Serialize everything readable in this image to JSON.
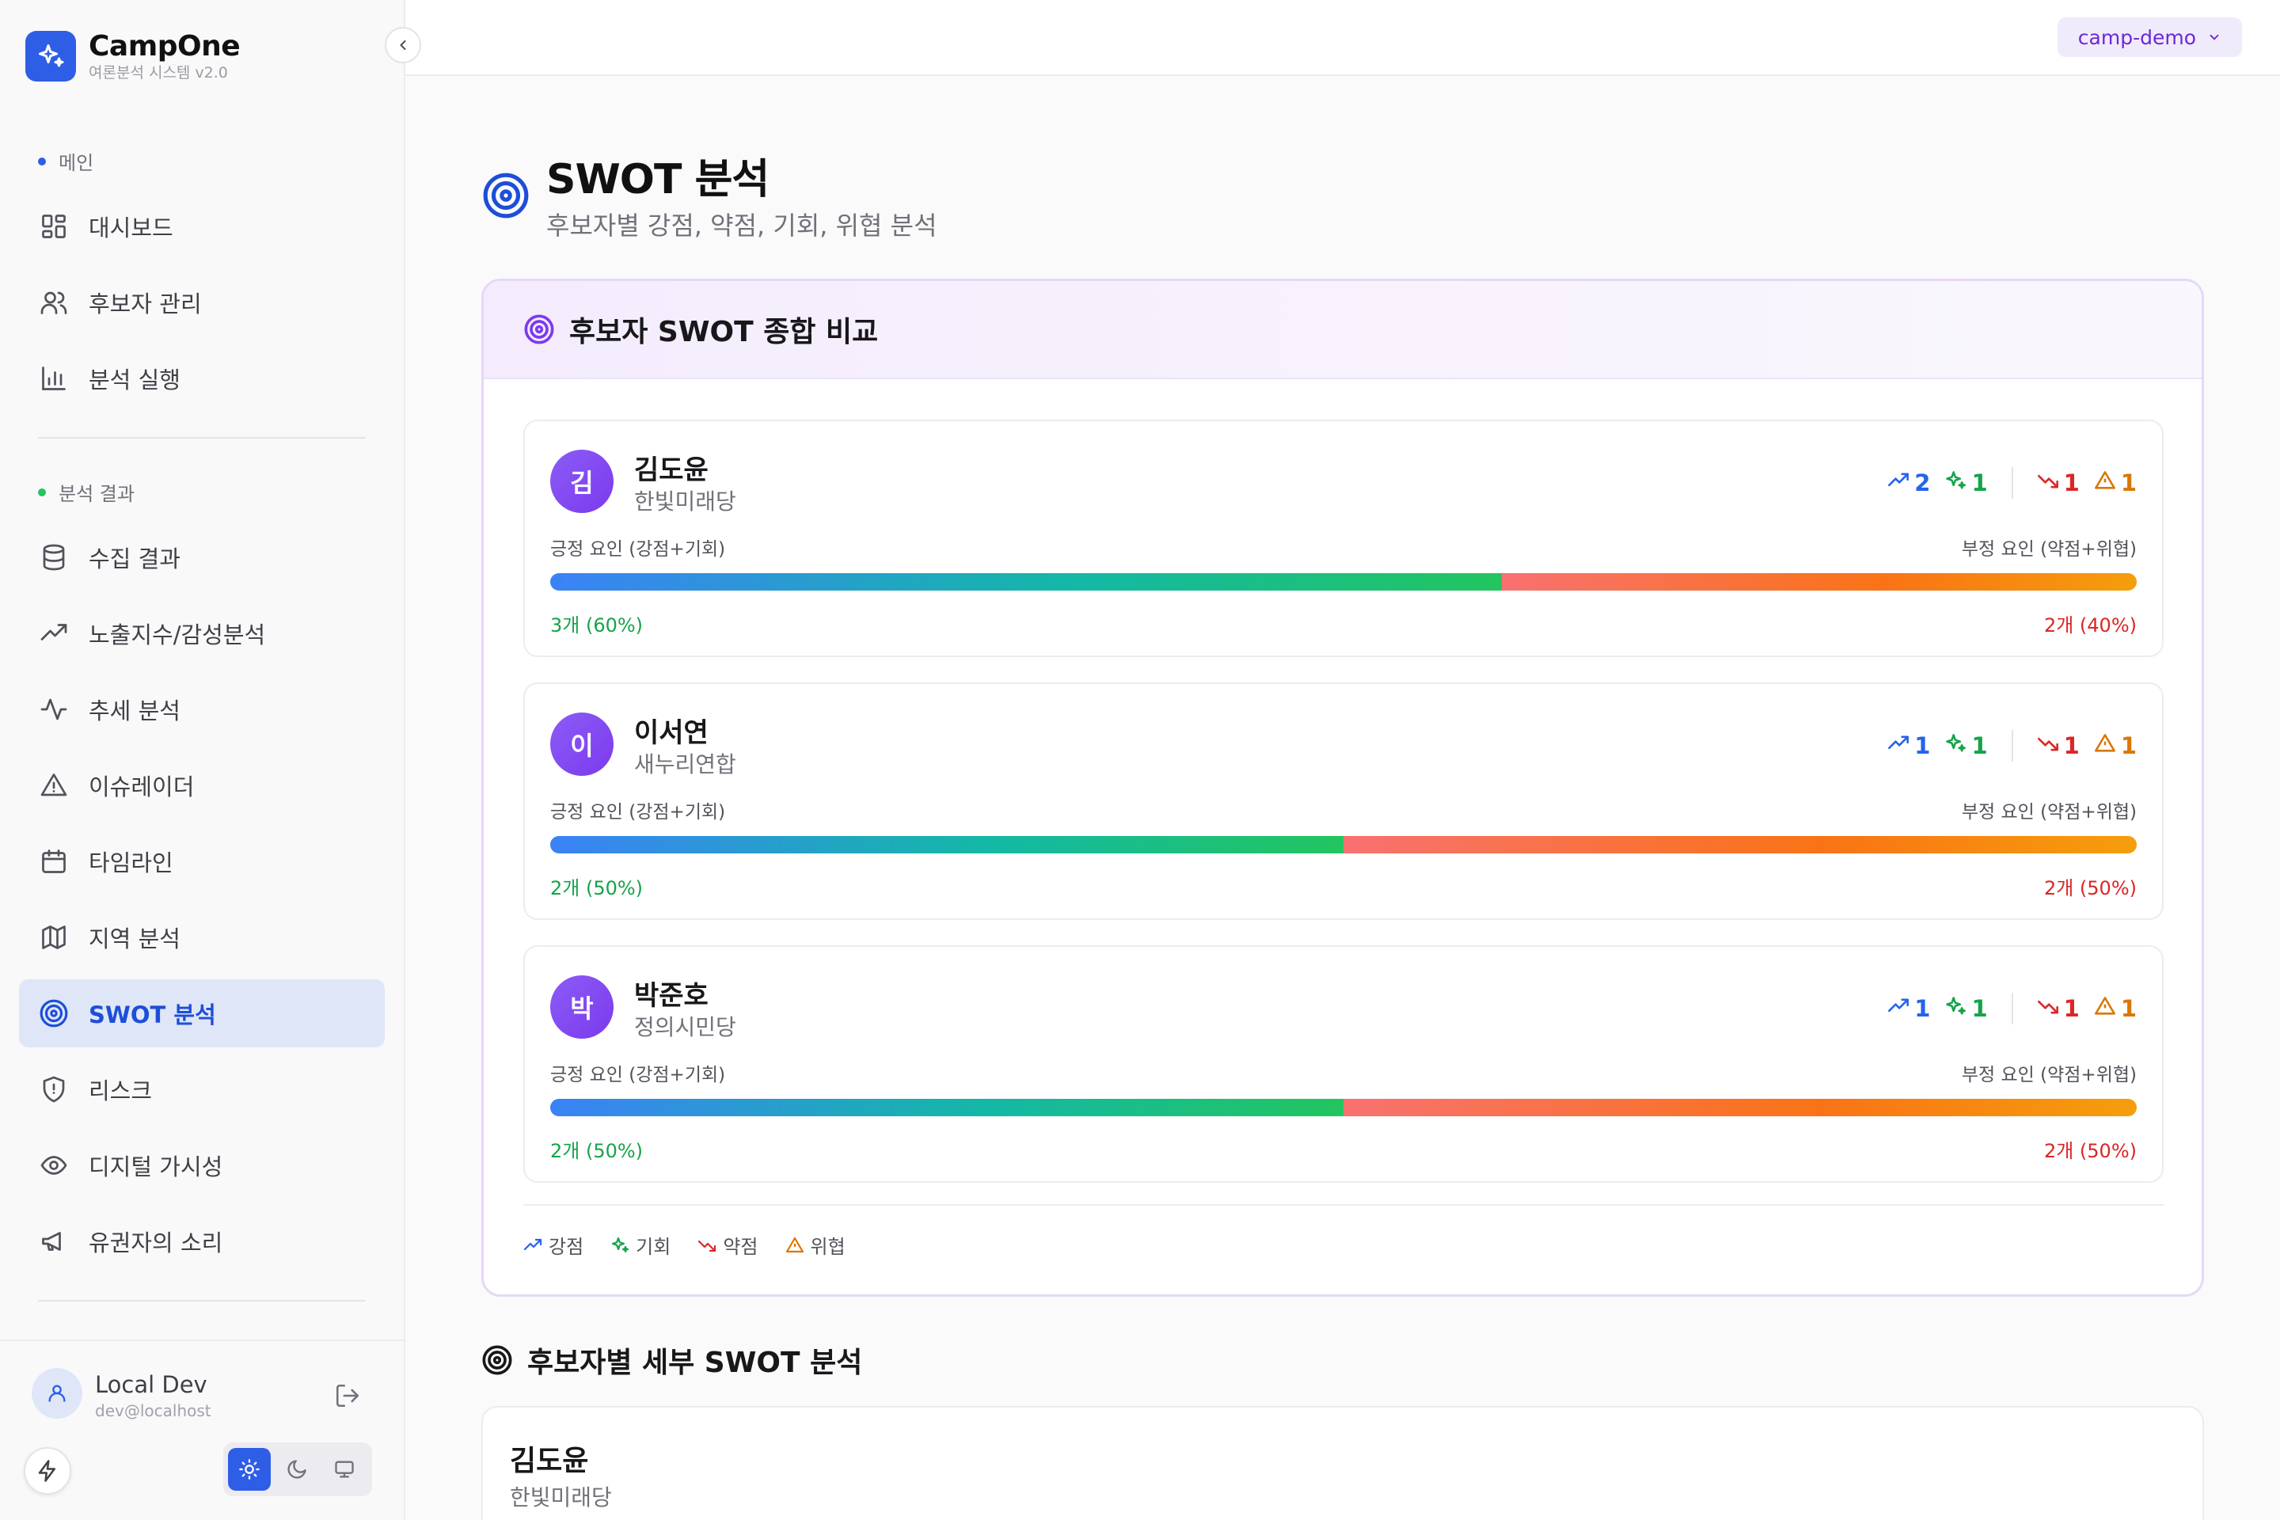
{
  "brand": {
    "name": "CampOne",
    "subtitle": "여론분석 시스템 v2.0"
  },
  "sidebar": {
    "section_main": "메인",
    "section_results": "분석 결과",
    "items": [
      {
        "label": "대시보드",
        "icon": "grid-icon"
      },
      {
        "label": "후보자 관리",
        "icon": "users-icon"
      },
      {
        "label": "분석 실행",
        "icon": "bar-chart-icon"
      },
      {
        "label": "수집 결과",
        "icon": "database-icon"
      },
      {
        "label": "노출지수/감성분석",
        "icon": "trending-up-icon"
      },
      {
        "label": "추세 분석",
        "icon": "activity-icon"
      },
      {
        "label": "이슈레이더",
        "icon": "alert-triangle-icon"
      },
      {
        "label": "타임라인",
        "icon": "calendar-icon"
      },
      {
        "label": "지역 분석",
        "icon": "map-icon"
      },
      {
        "label": "SWOT 분석",
        "icon": "target-icon",
        "active": true
      },
      {
        "label": "리스크",
        "icon": "shield-icon"
      },
      {
        "label": "디지털 가시성",
        "icon": "eye-icon"
      },
      {
        "label": "유권자의 소리",
        "icon": "megaphone-icon"
      }
    ]
  },
  "user": {
    "name": "Local Dev",
    "email": "dev@localhost"
  },
  "topbar": {
    "project": "camp-demo"
  },
  "page": {
    "title": "SWOT 분석",
    "subtitle": "후보자별 강점, 약점, 기회, 위협 분석"
  },
  "compare": {
    "title": "후보자 SWOT 종합 비교",
    "positive_label": "긍정 요인 (강점+기회)",
    "negative_label": "부정 요인 (약점+위협)",
    "candidates": [
      {
        "initial": "김",
        "name": "김도윤",
        "party": "한빛미래당",
        "strengths": "2",
        "opportunities": "1",
        "weaknesses": "1",
        "threats": "1",
        "positive_pct": 60,
        "positive_text": "3개 (60%)",
        "negative_text": "2개 (40%)"
      },
      {
        "initial": "이",
        "name": "이서연",
        "party": "새누리연합",
        "strengths": "1",
        "opportunities": "1",
        "weaknesses": "1",
        "threats": "1",
        "positive_pct": 50,
        "positive_text": "2개 (50%)",
        "negative_text": "2개 (50%)"
      },
      {
        "initial": "박",
        "name": "박준호",
        "party": "정의시민당",
        "strengths": "1",
        "opportunities": "1",
        "weaknesses": "1",
        "threats": "1",
        "positive_pct": 50,
        "positive_text": "2개 (50%)",
        "negative_text": "2개 (50%)"
      }
    ],
    "legend": {
      "strength": "강점",
      "opportunity": "기회",
      "weakness": "약점",
      "threat": "위협"
    }
  },
  "detail": {
    "title": "후보자별 세부 SWOT 분석",
    "first_name": "김도윤",
    "first_party": "한빛미래당"
  },
  "colors": {
    "accent": "#1d4ed8",
    "strength": "#2563eb",
    "opportunity": "#16a34a",
    "weakness": "#dc2626",
    "threat": "#d97706",
    "purple": "#7c3aed"
  }
}
